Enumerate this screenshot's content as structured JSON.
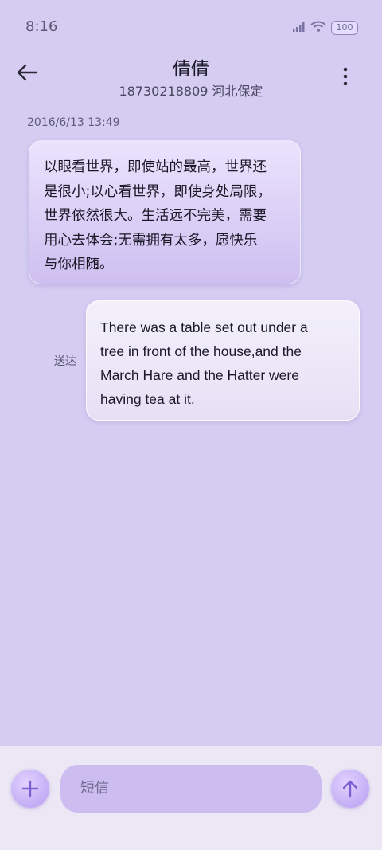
{
  "status_bar": {
    "time": "8:16",
    "battery": "100"
  },
  "header": {
    "contact_name": "倩倩",
    "contact_detail": "18730218809 河北保定"
  },
  "conversation": {
    "timestamp": "2016/6/13 13:49",
    "incoming": {
      "lines": [
        "以眼看世界，即使站的最高，世界还",
        "是很小;以心看世界，即使身处局限，",
        "世界依然很大。生活远不完美，需要",
        "用心去体会;无需拥有太多，愿快乐",
        "与你相随。"
      ]
    },
    "outgoing": {
      "status": "送达",
      "lines": [
        "There was a table set out under a",
        "tree in front of the house,and the",
        "March Hare and the Hatter were",
        "having tea at it."
      ]
    }
  },
  "composer": {
    "placeholder": "短信"
  },
  "icons": {
    "back": "arrow-left-icon",
    "more": "more-vertical-icon",
    "add": "plus-icon",
    "send": "arrow-up-icon",
    "signal": "signal-icon",
    "wifi": "wifi-icon",
    "battery": "battery-icon"
  },
  "colors": {
    "background": "#d5ccf2",
    "accent": "#b79df0"
  }
}
